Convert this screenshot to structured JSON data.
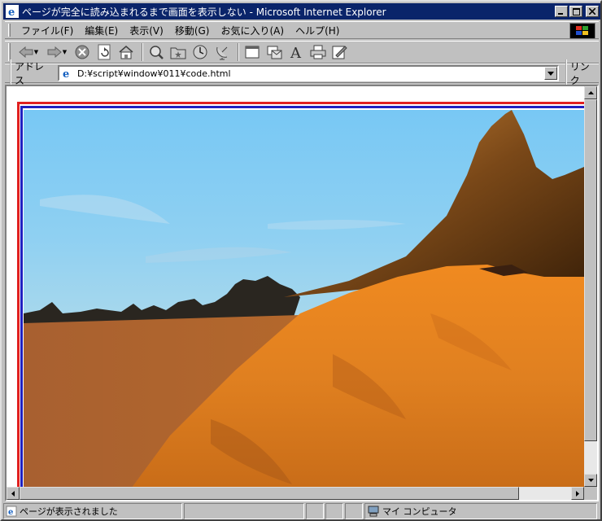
{
  "window": {
    "title": "ページが完全に読み込まれるまで画面を表示しない - Microsoft Internet Explorer"
  },
  "menu": {
    "items": [
      "ファイル(F)",
      "編集(E)",
      "表示(V)",
      "移動(G)",
      "お気に入り(A)",
      "ヘルプ(H)"
    ]
  },
  "address": {
    "label": "アドレス",
    "url": "D:¥script¥window¥011¥code.html",
    "links_label": "リンク"
  },
  "status": {
    "text": "ページが表示されました",
    "zone": "マイ コンピュータ"
  },
  "colors": {
    "titlebar": "#0a246a",
    "frame_outer": "#e02020",
    "frame_inner": "#2020c0",
    "sky": "#7fc8f0",
    "desert": "#e08a20"
  }
}
